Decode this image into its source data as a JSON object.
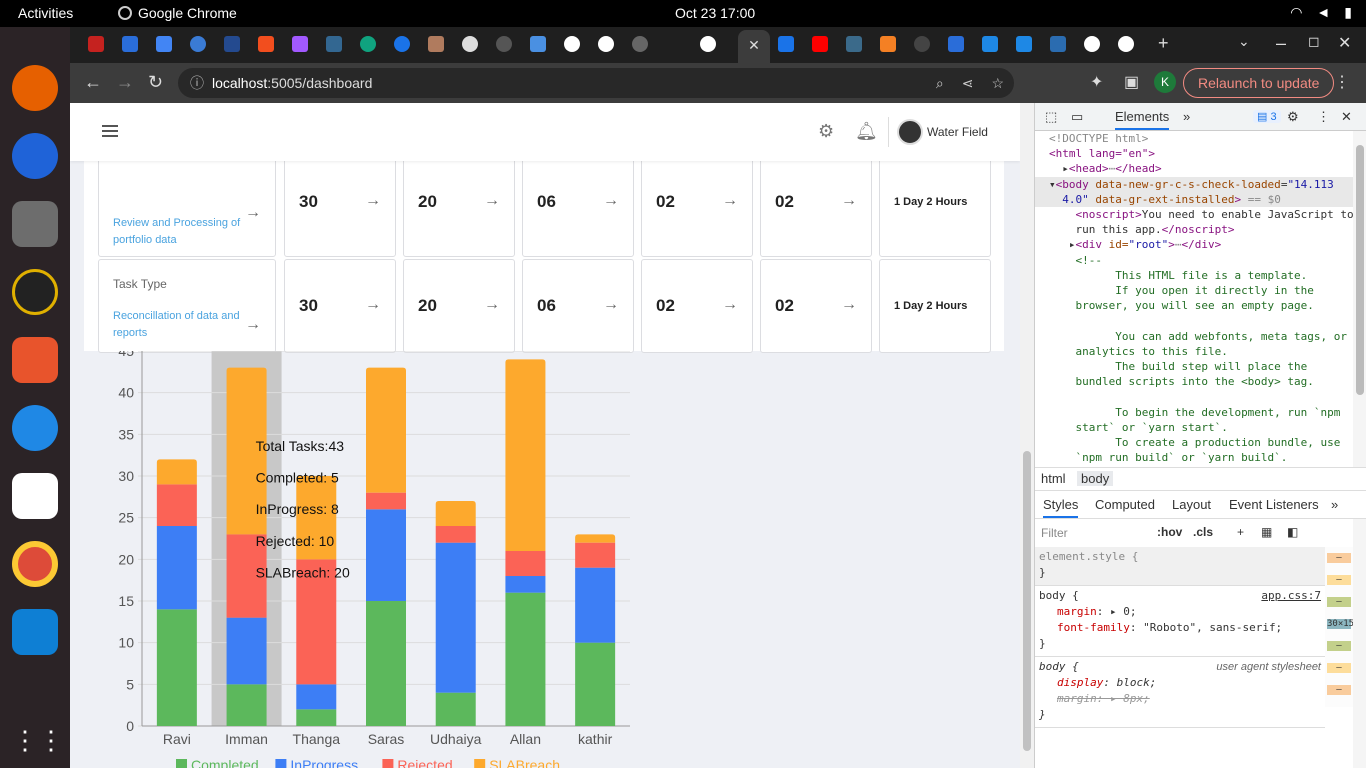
{
  "os": {
    "activities": "Activities",
    "app_name": "Google Chrome",
    "clock": "Oct 23  17:00"
  },
  "browser": {
    "url_host": "localhost",
    "url_path": ":5005/dashboard",
    "relaunch": "Relaunch to update",
    "profile_initial": "K"
  },
  "header": {
    "user_name": "Water Field"
  },
  "table": {
    "rows": [
      {
        "task_type_label": "",
        "task_type": "Review and Processing of portfolio data",
        "values": [
          "30",
          "20",
          "06",
          "02",
          "02"
        ],
        "duration": "1 Day 2 Hours"
      },
      {
        "task_type_label": "Task Type",
        "task_type": "Reconcillation of data and reports",
        "values": [
          "30",
          "20",
          "06",
          "02",
          "02"
        ],
        "duration": "1 Day 2 Hours"
      }
    ]
  },
  "chart_data": {
    "type": "bar",
    "stacked": true,
    "categories": [
      "Ravi",
      "Imman",
      "Thanga",
      "Saras",
      "Udhaiya",
      "Allan",
      "kathir"
    ],
    "series": [
      {
        "name": "Completed",
        "color": "#5cb85c",
        "values": [
          14,
          5,
          2,
          15,
          4,
          16,
          10
        ]
      },
      {
        "name": "InProgress",
        "color": "#3d7ef5",
        "values": [
          10,
          8,
          3,
          11,
          18,
          2,
          9
        ]
      },
      {
        "name": "Rejected",
        "color": "#fb6356",
        "values": [
          5,
          10,
          15,
          2,
          2,
          3,
          3
        ]
      },
      {
        "name": "SLABreach",
        "color": "#fda92d",
        "values": [
          3,
          20,
          10,
          15,
          3,
          23,
          1
        ]
      }
    ],
    "ylim": [
      0,
      45
    ],
    "yticks": [
      "0",
      "5",
      "10",
      "15",
      "20",
      "25",
      "30",
      "35",
      "40",
      "45"
    ],
    "grid": true,
    "legend": "bottom",
    "highlight_category": "Imman",
    "tooltip": {
      "lines": [
        "Total Tasks:43",
        "Completed: 5",
        "InProgress: 8",
        "Rejected: 10",
        "SLABreach: 20"
      ]
    }
  },
  "devtools": {
    "tabs": {
      "elements": "Elements",
      "badge": "3"
    },
    "code": {
      "doctype": "<!DOCTYPE html>",
      "html_open": "<html lang=\"en\">",
      "head": "<head>",
      "head_ellipsis": "⋯",
      "head_close": "</head>",
      "body_attr1_name": "data-new-gr-c-s-check-loaded",
      "body_attr1_val": "\"14.113",
      "body_attr1_val2": "4.0\"",
      "body_attr2": "data-gr-ext-installed",
      "body_eq": "== $0",
      "noscript1": "You need to enable JavaScript to",
      "noscript2": "run this app.",
      "div_root_attr": "id=",
      "div_root_val": "\"root\"",
      "comment_open": "<!--",
      "c1": "      This HTML file is a template.",
      "c2": "      If you open it directly in the",
      "c3": "browser, you will see an empty page.",
      "c4": "      You can add webfonts, meta tags, or",
      "c5": "analytics to this file.",
      "c6": "      The build step will place the",
      "c7": "bundled scripts into the <body> tag.",
      "c8": "      To begin the development, run `npm",
      "c9": "start` or `yarn start`.",
      "c10": "      To create a production bundle, use",
      "c11": "`npm run build` or `yarn build`."
    },
    "crumbs": [
      "html",
      "body"
    ],
    "style_tabs": [
      "Styles",
      "Computed",
      "Layout",
      "Event Listeners"
    ],
    "filter_placeholder": "Filter",
    "hov": ":hov",
    "cls": ".cls",
    "rules": {
      "r1_selector": "element.style {",
      "r2_selector": "body {",
      "r2_source": "app.css:7",
      "r2_p1": "margin",
      "r2_v1": "▸ 0;",
      "r2_p2": "font-family",
      "r2_v2": "\"Roboto\", sans-serif;",
      "r3_selector": "body {",
      "r3_source": "user agent stylesheet",
      "r3_p1": "display",
      "r3_v1": "block;",
      "r3_p2": "margin",
      "r3_v2": "▸ 8px;",
      "close": "}"
    },
    "boxmodel": [
      "–",
      "–",
      "–",
      "30×15",
      "–",
      "–",
      "–"
    ]
  }
}
